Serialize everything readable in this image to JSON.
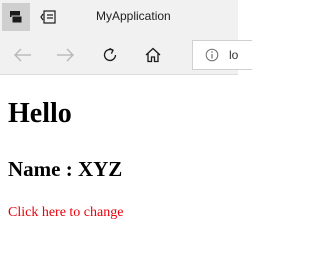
{
  "window": {
    "title": "MyApplication"
  },
  "navigation": {
    "address_text": "lo"
  },
  "page": {
    "heading": "Hello",
    "subheading": "Name : XYZ",
    "link_text": "Click here to change"
  },
  "colors": {
    "link": "#e8000b",
    "chrome_background": "#f1f1f1",
    "active_tab_button": "#cfcfcf"
  },
  "icons": {
    "tabs": "tabs-icon",
    "tabs_aside": "tabs-aside-icon",
    "back": "arrow-left-icon",
    "forward": "arrow-right-icon",
    "refresh": "refresh-icon",
    "home": "home-icon",
    "info": "info-icon"
  }
}
